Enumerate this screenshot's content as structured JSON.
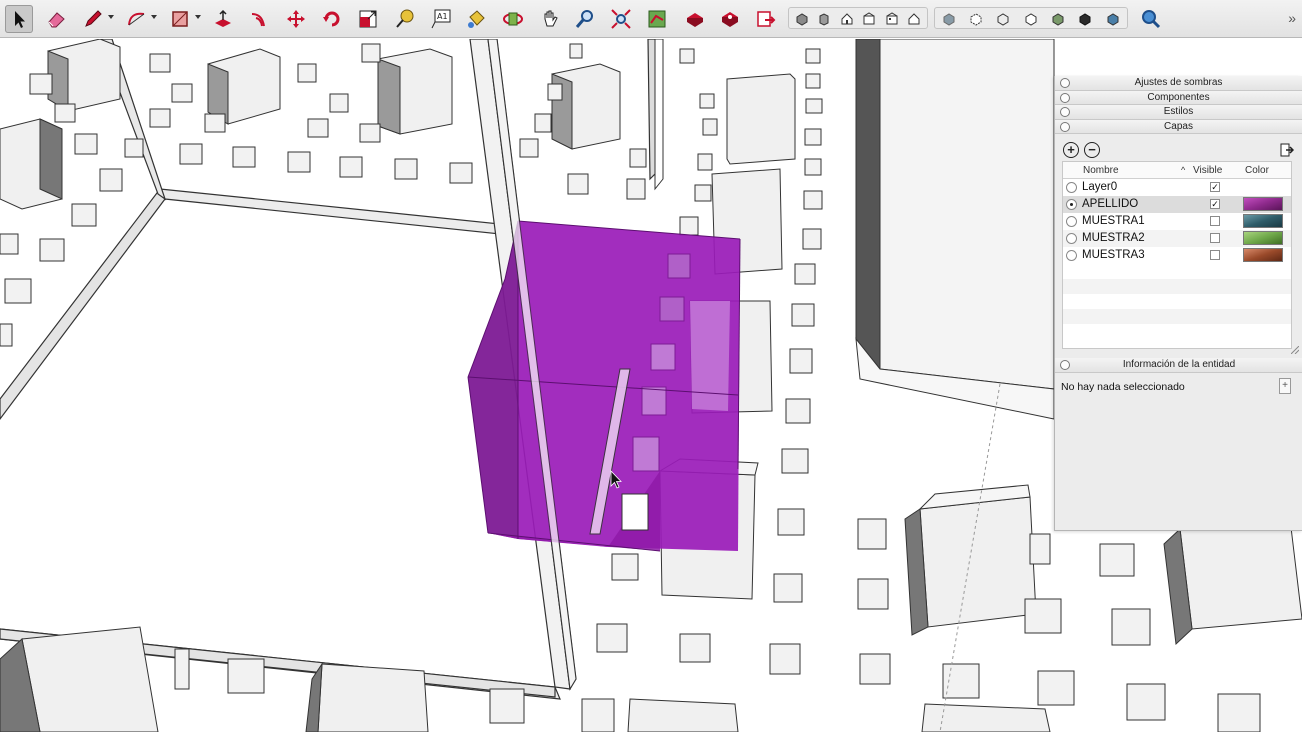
{
  "toolbar": {
    "tools": [
      {
        "name": "select-tool",
        "icon": "arrow-icon"
      },
      {
        "name": "eraser-tool",
        "icon": "eraser-icon"
      },
      {
        "name": "pencil-tool",
        "icon": "pencil-icon"
      },
      {
        "name": "arc-tool",
        "icon": "arc-icon"
      },
      {
        "name": "rectangle-tool",
        "icon": "rectangle-icon"
      },
      {
        "name": "push-pull-tool",
        "icon": "push-pull-icon"
      },
      {
        "name": "offset-tool",
        "icon": "offset-icon"
      },
      {
        "name": "move-tool",
        "icon": "move-icon"
      },
      {
        "name": "rotate-tool",
        "icon": "rotate-icon"
      },
      {
        "name": "scale-tool",
        "icon": "scale-icon"
      },
      {
        "name": "tape-measure-tool",
        "icon": "tape-measure-icon"
      },
      {
        "name": "text-tool",
        "icon": "text-icon"
      },
      {
        "name": "paint-bucket-tool",
        "icon": "paint-bucket-icon"
      },
      {
        "name": "orbit-tool",
        "icon": "orbit-icon"
      },
      {
        "name": "pan-tool",
        "icon": "hand-icon"
      },
      {
        "name": "zoom-tool",
        "icon": "magnifier-icon"
      },
      {
        "name": "zoom-extents-tool",
        "icon": "zoom-extents-icon"
      },
      {
        "name": "map-location-tool",
        "icon": "map-icon"
      },
      {
        "name": "warehouse-tool",
        "icon": "warehouse-icon"
      },
      {
        "name": "extension-warehouse-tool",
        "icon": "extension-warehouse-icon"
      },
      {
        "name": "layout-send-tool",
        "icon": "send-to-layout-icon"
      }
    ],
    "text_tool_label": "A1",
    "views": [
      "iso-view-icon",
      "top-view-icon",
      "front-view-icon",
      "right-view-icon",
      "back-view-icon",
      "left-view-icon"
    ],
    "styles": [
      "xray-style-icon",
      "back-edges-style-icon",
      "wireframe-style-icon",
      "hidden-line-style-icon",
      "shaded-style-icon",
      "shaded-textures-style-icon",
      "monochrome-style-icon"
    ],
    "overflow_label": "»",
    "accent_color": "#c8102e"
  },
  "tray": {
    "panels": {
      "shadows": "Ajustes de sombras",
      "components": "Componentes",
      "styles": "Estilos",
      "layers": "Capas",
      "entity_info": "Información de la entidad"
    },
    "layers": {
      "add_label": "+",
      "remove_label": "−",
      "columns": {
        "name": "Nombre",
        "visible": "Visible",
        "color": "Color",
        "sort_indicator": "^"
      },
      "rows": [
        {
          "name": "Layer0",
          "active": false,
          "visible": true,
          "color": "#ffffff",
          "visible_mark": "✓"
        },
        {
          "name": "APELLIDO",
          "active": true,
          "visible": true,
          "color": "#8e2a8c",
          "visible_mark": "✓"
        },
        {
          "name": "MUESTRA1",
          "active": false,
          "visible": false,
          "color": "#2f5d6a",
          "visible_mark": ""
        },
        {
          "name": "MUESTRA2",
          "active": false,
          "visible": false,
          "color": "#6fa84a",
          "visible_mark": ""
        },
        {
          "name": "MUESTRA3",
          "active": false,
          "visible": false,
          "color": "#9a4a2a",
          "visible_mark": ""
        }
      ]
    },
    "entity_info": {
      "message": "No hay nada seleccionado",
      "button_label": "+"
    }
  },
  "scene": {
    "selection_color": "#9a1bb8"
  }
}
